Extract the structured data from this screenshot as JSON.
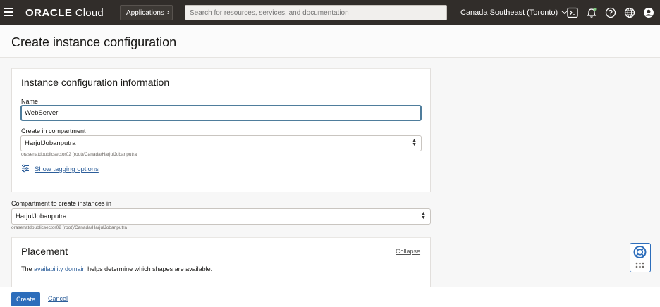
{
  "topbar": {
    "brand_bold": "ORACLE",
    "brand_light": " Cloud",
    "apps_label": "Applications",
    "search_placeholder": "Search for resources, services, and documentation",
    "region": "Canada Southeast (Toronto)"
  },
  "page": {
    "title": "Create instance configuration"
  },
  "info_card": {
    "title": "Instance configuration information",
    "name_label": "Name",
    "name_value": "WebServer",
    "compartment_label": "Create in compartment",
    "compartment_value": "HarjulJobanputra",
    "compartment_path": "orasenatdpublicsector02 (root)/Canada/HarjulJobanputra",
    "tagging_link": "Show tagging options"
  },
  "instances_compartment": {
    "label": "Compartment to create instances in",
    "value": "HarjulJobanputra",
    "path": "orasenatdpublicsector02 (root)/Canada/HarjulJobanputra"
  },
  "placement": {
    "title": "Placement",
    "collapse_label": "Collapse",
    "text_pre": "The ",
    "text_link": "availability domain",
    "text_post": " helps determine which shapes are available."
  },
  "footer": {
    "create_label": "Create",
    "cancel_label": "Cancel"
  },
  "colors": {
    "topbar": "#312d2a",
    "primary": "#2c6dbb",
    "link": "#2c5e9a"
  },
  "icons": [
    "hamburger-icon",
    "chevron-right-icon",
    "chevron-down-icon",
    "cloud-shell-icon",
    "bell-icon",
    "help-icon",
    "globe-icon",
    "user-icon",
    "tag-settings-icon",
    "select-arrows-icon",
    "help-widget-icon"
  ]
}
